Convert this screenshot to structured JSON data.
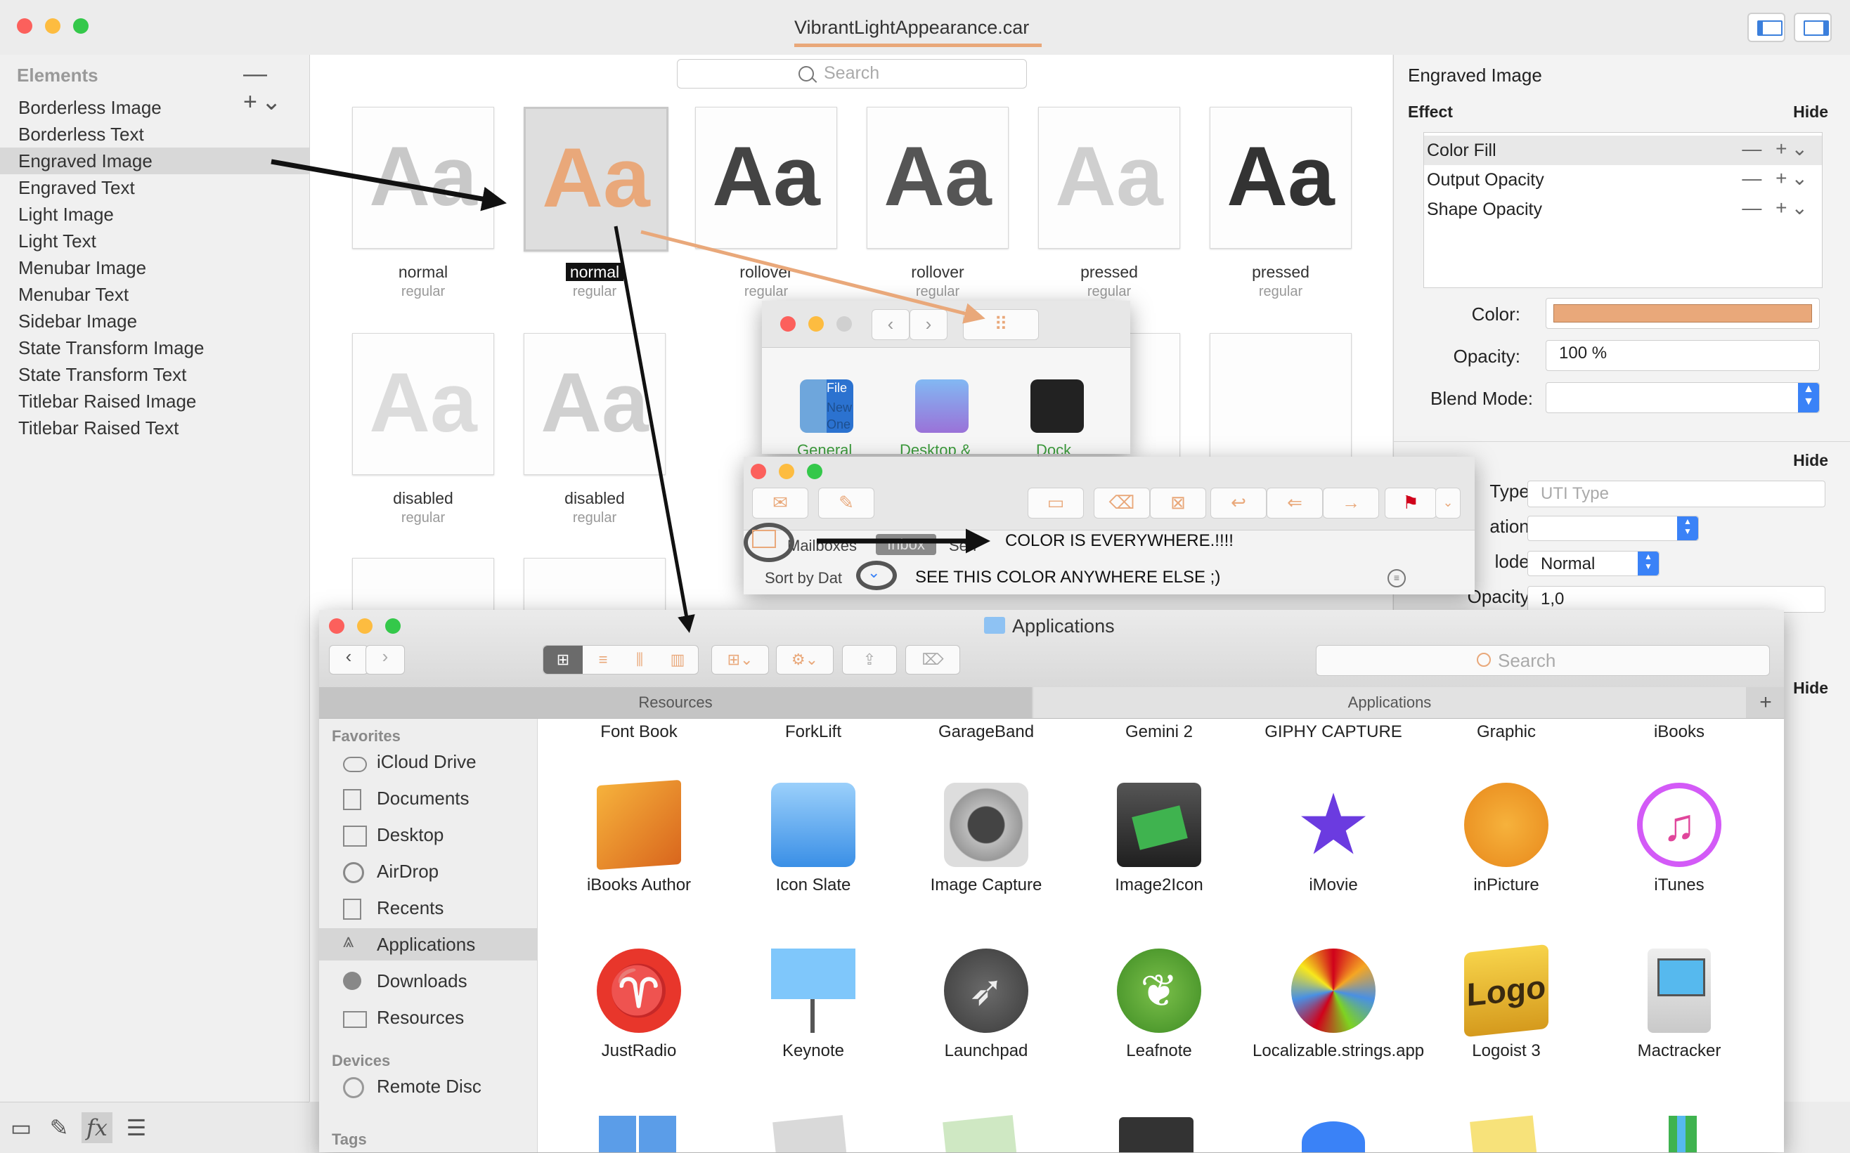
{
  "window": {
    "title": "VibrantLightAppearance.car"
  },
  "sidebar": {
    "header": "Elements",
    "controls": "— +⌄",
    "items": [
      {
        "label": "Borderless Image"
      },
      {
        "label": "Borderless Text"
      },
      {
        "label": "Engraved Image"
      },
      {
        "label": "Engraved Text"
      },
      {
        "label": "Light Image"
      },
      {
        "label": "Light Text"
      },
      {
        "label": "Menubar Image"
      },
      {
        "label": "Menubar Text"
      },
      {
        "label": "Sidebar Image"
      },
      {
        "label": "State Transform Image"
      },
      {
        "label": "State Transform Text"
      },
      {
        "label": "Titlebar Raised Image"
      },
      {
        "label": "Titlebar Raised Text"
      }
    ],
    "selected_index": 2
  },
  "center": {
    "search_placeholder": "Search",
    "glyph": "Aa",
    "cells": [
      {
        "state": "normal",
        "sub": "regular"
      },
      {
        "state": "normal",
        "sub": "regular"
      },
      {
        "state": "rollover",
        "sub": "regular"
      },
      {
        "state": "rollover",
        "sub": "regular"
      },
      {
        "state": "pressed",
        "sub": "regular"
      },
      {
        "state": "pressed",
        "sub": "regular"
      },
      {
        "state": "disabled",
        "sub": "regular"
      },
      {
        "state": "disabled",
        "sub": "regular"
      }
    ]
  },
  "inspector": {
    "title": "Engraved Image",
    "effect_section": "Effect",
    "hide": "Hide",
    "effects": [
      {
        "label": "Color Fill"
      },
      {
        "label": "Output Opacity"
      },
      {
        "label": "Shape Opacity"
      }
    ],
    "effect_controls": "— +⌄",
    "color_label": "Color:",
    "color_value": "#e9a87a",
    "opacity_label": "Opacity:",
    "opacity_value": "100 %",
    "blend_label": "Blend Mode:",
    "type_label": "Type:",
    "type_placeholder": "UTI Type",
    "ation_label": "ation:",
    "mode_label": "lode:",
    "mode_value": "Normal",
    "opacity2_label": "Opacity:",
    "opacity2_value": "1,0"
  },
  "prefs_window": {
    "labels": [
      "General",
      "Desktop &",
      "Dock"
    ],
    "file_label": "File",
    "new_label": "New",
    "one_label": "One"
  },
  "mail_window": {
    "mailboxes": "Mailboxes",
    "inbox": "Inbox",
    "sent": "Sen",
    "sort_by": "Sort by Dat",
    "annotation1": "COLOR IS EVERYWHERE.!!!!",
    "annotation2": "SEE THIS COLOR ANYWHERE ELSE ;)"
  },
  "finder": {
    "title": "Applications",
    "search_placeholder": "Search",
    "tab_resources": "Resources",
    "tab_applications": "Applications",
    "favorites_header": "Favorites",
    "devices_header": "Devices",
    "tags_header": "Tags",
    "favorites": [
      {
        "label": "iCloud Drive",
        "icon": "cloud-icon"
      },
      {
        "label": "Documents",
        "icon": "documents-icon"
      },
      {
        "label": "Desktop",
        "icon": "desktop-icon"
      },
      {
        "label": "AirDrop",
        "icon": "airdrop-icon"
      },
      {
        "label": "Recents",
        "icon": "recents-icon"
      },
      {
        "label": "Applications",
        "icon": "applications-icon"
      },
      {
        "label": "Downloads",
        "icon": "downloads-icon"
      },
      {
        "label": "Resources",
        "icon": "folder-icon"
      }
    ],
    "devices": [
      {
        "label": "Remote Disc",
        "icon": "disc-icon"
      }
    ],
    "top_row": [
      "Font Book",
      "ForkLift",
      "GarageBand",
      "Gemini 2",
      "GIPHY CAPTURE",
      "Graphic",
      "iBooks"
    ],
    "row1": [
      "iBooks Author",
      "Icon Slate",
      "Image Capture",
      "Image2Icon",
      "iMovie",
      "inPicture",
      "iTunes"
    ],
    "row2": [
      "JustRadio",
      "Keynote",
      "Launchpad",
      "Leafnote",
      "Localizable.strings.app",
      "Logoist 3",
      "Mactracker"
    ]
  },
  "colors": {
    "accent": "#e9a87a",
    "selection": "#3a82f7"
  }
}
